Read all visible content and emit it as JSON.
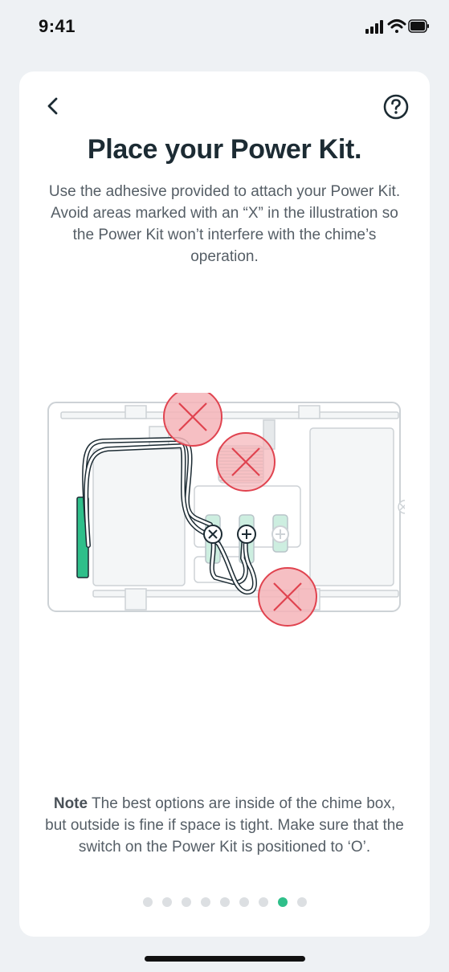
{
  "status_bar": {
    "time": "9:41",
    "icons": [
      "cellular-signal-icon",
      "wifi-icon",
      "battery-icon"
    ]
  },
  "header": {
    "back_icon": "chevron-left-icon",
    "help_icon": "question-circle-icon"
  },
  "content": {
    "title": "Place your Power Kit.",
    "description": "Use the adhesive provided to attach your Power Kit. Avoid areas marked with an “X” in the illustration so the Power Kit won’t interfere with the chime’s operation.",
    "note_label": "Note",
    "note_text": " The best options are inside of the chime box, but outside is fine if space is tight. Make sure that the switch on the Power Kit is positioned to ‘O’."
  },
  "pagination": {
    "total": 9,
    "active_index": 7
  },
  "colors": {
    "accent": "#2fbf8a",
    "avoid_fill": "#f5b4b8",
    "avoid_stroke": "#e0434f",
    "power_kit": "#2fbf8a",
    "title": "#1c2b33",
    "body_text": "#555e66"
  }
}
